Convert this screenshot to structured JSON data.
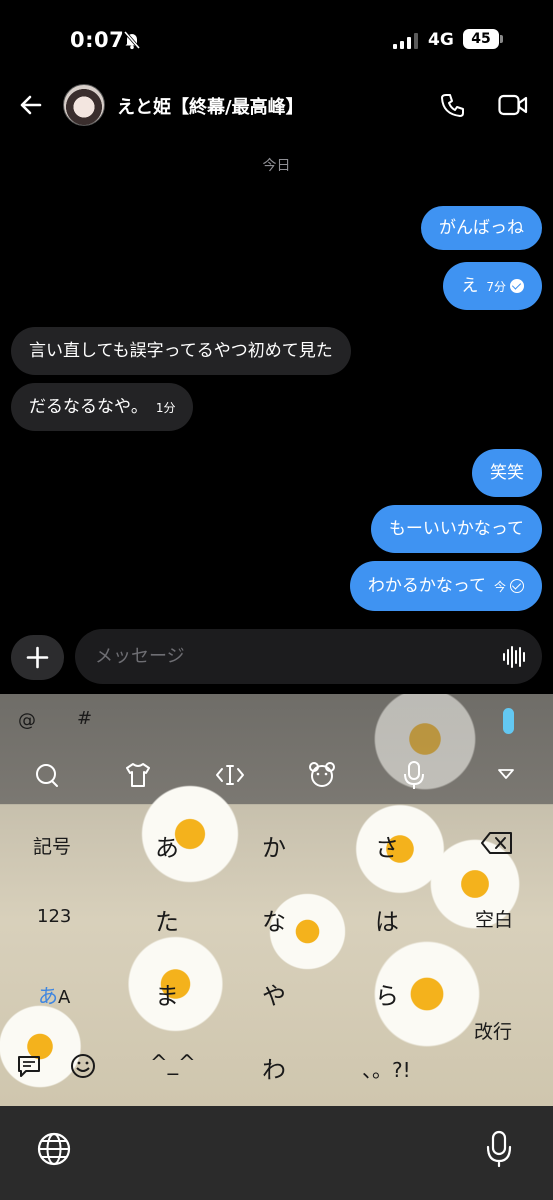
{
  "status_bar": {
    "time": "0:07",
    "network": "4G",
    "battery": "45"
  },
  "header": {
    "contact_name": "えと姫【終幕/最高峰】"
  },
  "date_label": "今日",
  "messages": [
    {
      "text": "がんばっね",
      "time": "",
      "dir": "out"
    },
    {
      "text": "え",
      "time": "7分",
      "dir": "out"
    },
    {
      "text": "言い直しても誤字ってるやつ初めて見た",
      "time": "",
      "dir": "in"
    },
    {
      "text": "だるなるなや。",
      "time": "1分",
      "dir": "in"
    },
    {
      "text": "笑笑",
      "time": "",
      "dir": "out"
    },
    {
      "text": "もーいいかなって",
      "time": "",
      "dir": "out"
    },
    {
      "text": "わかるかなって",
      "time": "今",
      "dir": "out"
    }
  ],
  "composer": {
    "placeholder": "メッセージ"
  },
  "keyboard": {
    "top_row": [
      "@",
      "#"
    ],
    "keys": {
      "symbols": "記号",
      "a": "あ",
      "ka": "か",
      "sa": "さ",
      "numbers": "123",
      "ta": "た",
      "na": "な",
      "ha": "は",
      "space": "空白",
      "kana_a": "あ",
      "kana_A": "A",
      "ma": "ま",
      "ya": "や",
      "ra": "ら",
      "enter": "改行",
      "kaomoji": "^_^",
      "wa": "わ",
      "punct": "、。?!"
    }
  }
}
